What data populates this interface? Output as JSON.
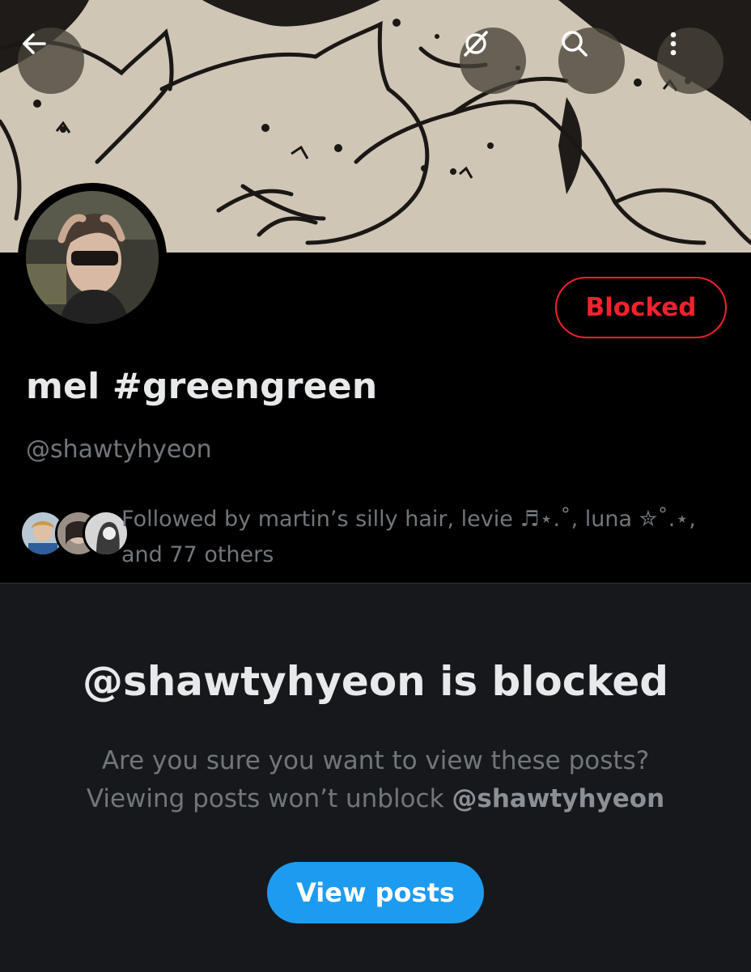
{
  "banner": {
    "back_icon": "arrow-left-icon",
    "grok_icon": "grok-icon",
    "search_icon": "search-icon",
    "more_icon": "more-vertical-icon"
  },
  "profile": {
    "display_name": "mel #greengreen",
    "handle": "@shawtyhyeon",
    "blocked_label": "Blocked",
    "followed_by": "Followed by martin’s silly hair, levie ♬⋆.˚, luna ✮˚.⋆,",
    "followed_by_more": "and 77 others"
  },
  "blocked_panel": {
    "title": "@shawtyhyeon is blocked",
    "line1": "Are you sure you want to view these posts?",
    "line2_prefix": "Viewing posts won’t unblock ",
    "line2_handle": "@shawtyhyeon",
    "button_label": "View posts"
  },
  "colors": {
    "accent": "#1d9bf0",
    "blocked_red": "#f4212e",
    "text_primary": "#e7e9ea",
    "text_secondary": "#71767b",
    "panel_bg": "#16181c"
  }
}
